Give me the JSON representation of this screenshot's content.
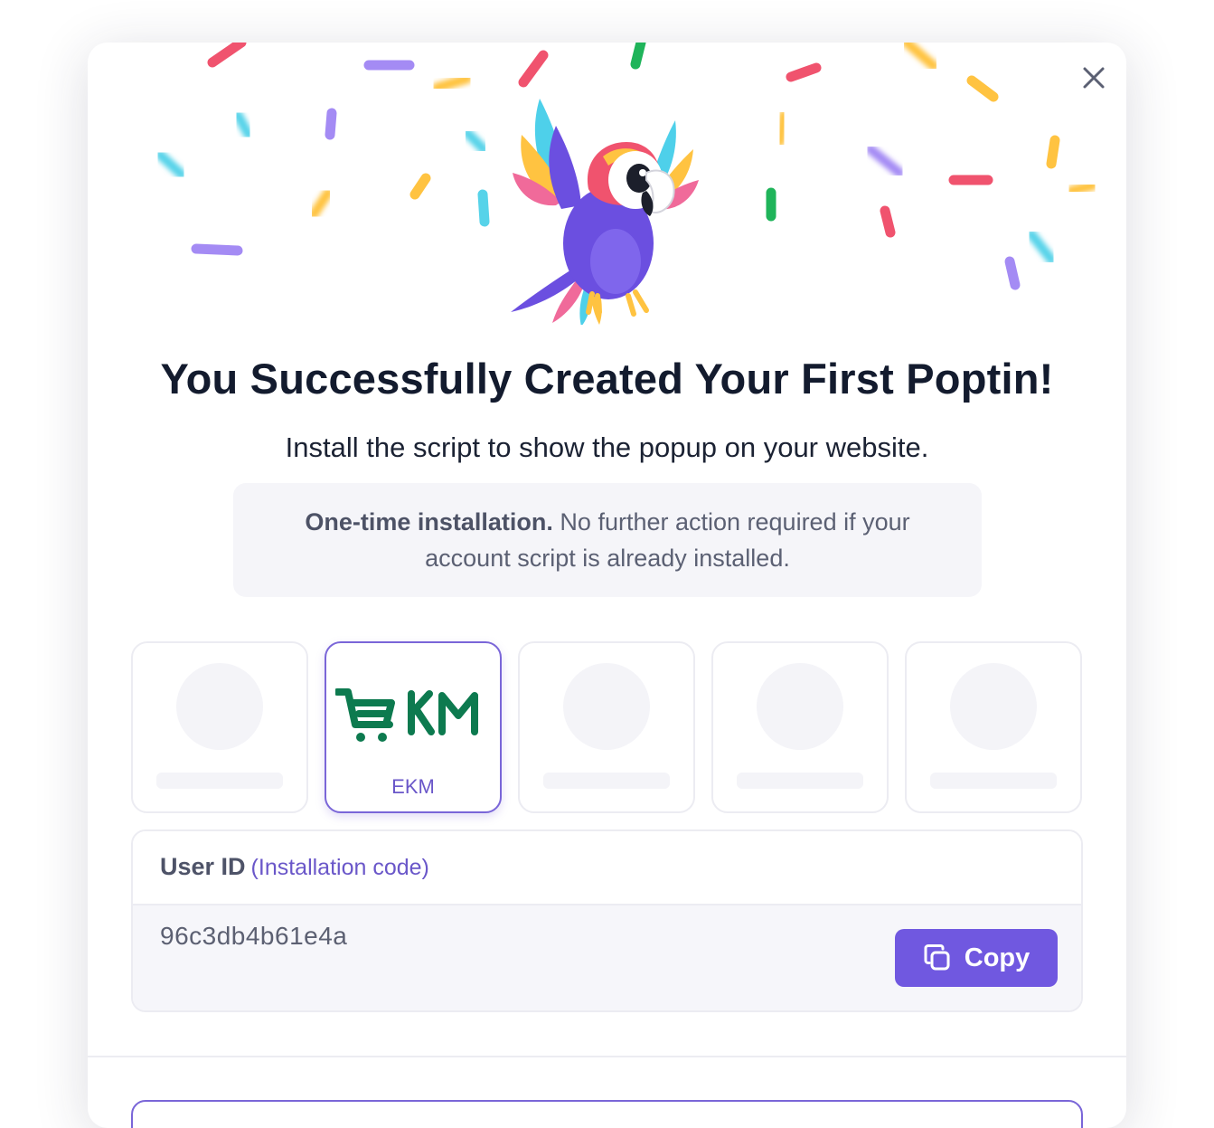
{
  "dialog": {
    "title": "You Successfully Created Your First Poptin!",
    "subtitle": "Install the script to show the popup on your website.",
    "note": {
      "bold": "One-time installation.",
      "text": " No further action required if your account script is already installed."
    }
  },
  "platforms": [
    {
      "label": "",
      "state": "loading"
    },
    {
      "label": "EKM",
      "state": "selected",
      "logo_text": "EKM"
    },
    {
      "label": "",
      "state": "loading"
    },
    {
      "label": "",
      "state": "loading"
    },
    {
      "label": "",
      "state": "loading"
    }
  ],
  "user_id": {
    "title": "User ID",
    "subtitle": "(Installation code)",
    "value": "96c3db4b61e4a",
    "copy_label": "Copy"
  },
  "colors": {
    "accent": "#7058e0",
    "selected_border": "#7a66d8",
    "title": "#131b2e",
    "ekm_green": "#0d7a4f"
  },
  "icons": [
    "close-icon",
    "parrot-mascot",
    "copy-icon",
    "ekm-cart-logo"
  ]
}
